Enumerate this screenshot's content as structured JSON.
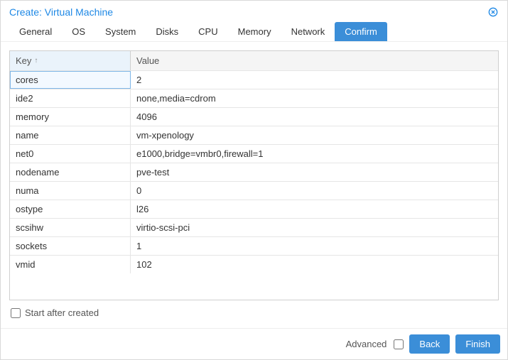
{
  "titlebar": {
    "title": "Create: Virtual Machine"
  },
  "tabs": [
    {
      "label": "General"
    },
    {
      "label": "OS"
    },
    {
      "label": "System"
    },
    {
      "label": "Disks"
    },
    {
      "label": "CPU"
    },
    {
      "label": "Memory"
    },
    {
      "label": "Network"
    },
    {
      "label": "Confirm",
      "active": true
    }
  ],
  "grid": {
    "columns": {
      "key": "Key",
      "value": "Value",
      "sort": "↑"
    },
    "rows": [
      {
        "key": "cores",
        "value": "2",
        "selected": true
      },
      {
        "key": "ide2",
        "value": "none,media=cdrom"
      },
      {
        "key": "memory",
        "value": "4096"
      },
      {
        "key": "name",
        "value": "vm-xpenology"
      },
      {
        "key": "net0",
        "value": "e1000,bridge=vmbr0,firewall=1"
      },
      {
        "key": "nodename",
        "value": "pve-test"
      },
      {
        "key": "numa",
        "value": "0"
      },
      {
        "key": "ostype",
        "value": "l26"
      },
      {
        "key": "scsihw",
        "value": "virtio-scsi-pci"
      },
      {
        "key": "sockets",
        "value": "1"
      },
      {
        "key": "vmid",
        "value": "102"
      }
    ]
  },
  "options": {
    "start_after_created_label": "Start after created",
    "advanced_label": "Advanced"
  },
  "buttons": {
    "back": "Back",
    "finish": "Finish"
  }
}
